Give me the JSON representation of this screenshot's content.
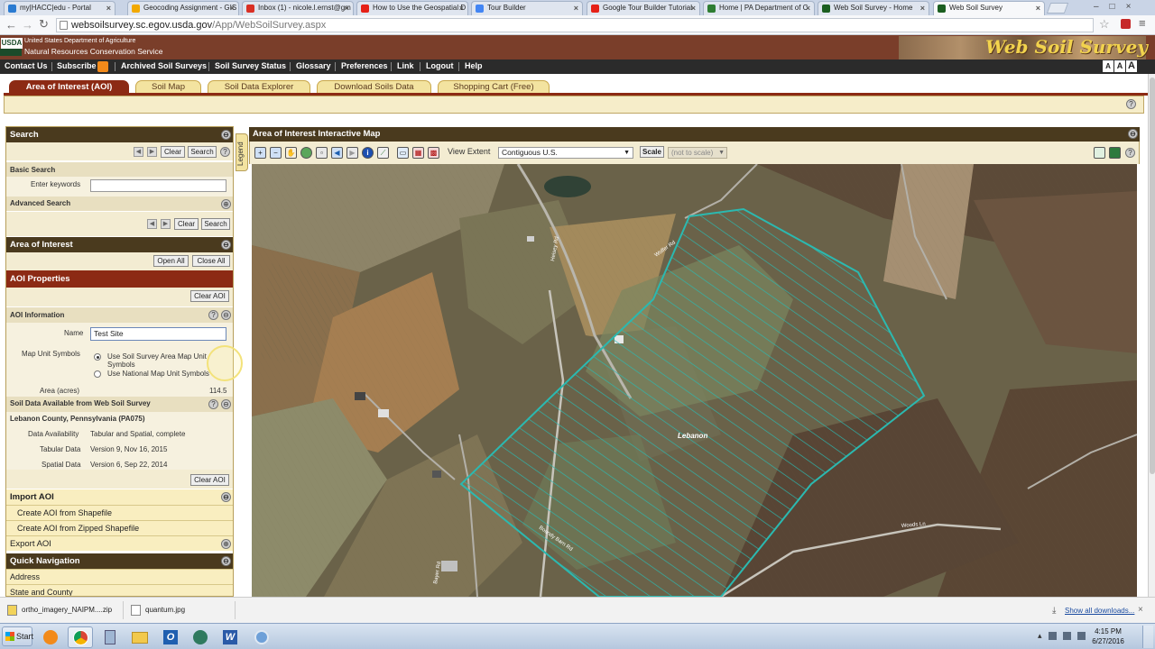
{
  "browser": {
    "tabs": [
      {
        "title": "my|HACC|edu - Portal",
        "color": "#2b7bd1"
      },
      {
        "title": "Geocoding Assignment - GIS",
        "color": "#f2a900"
      },
      {
        "title": "Inbox (1) - nicole.l.ernst@gm",
        "color": "#d93025"
      },
      {
        "title": "How to Use the Geospatial D",
        "color": "#e62117"
      },
      {
        "title": "Tour Builder",
        "color": "#4285f4"
      },
      {
        "title": "Google Tour Builder Tutorial",
        "color": "#e62117"
      },
      {
        "title": "Home | PA Department of C",
        "color": "#2e7d32"
      },
      {
        "title": "Web Soil Survey - Home",
        "color": "#1b5e20"
      },
      {
        "title": "Web Soil Survey",
        "color": "#1b5e20"
      }
    ],
    "url_host": "websoilsurvey.sc.egov.usda.gov",
    "url_path": "/App/WebSoilSurvey.aspx"
  },
  "header": {
    "agency_line1": "United States Department of Agriculture",
    "agency_line2": "Natural Resources Conservation Service",
    "usda": "USDA",
    "logo_title": "Web Soil Survey",
    "font_sizes": [
      "A",
      "A",
      "A"
    ]
  },
  "nav": [
    "Contact Us",
    "Subscribe",
    "Archived Soil Surveys",
    "Soil Survey Status",
    "Glossary",
    "Preferences",
    "Link",
    "Logout",
    "Help"
  ],
  "main_tabs": [
    "Area of Interest (AOI)",
    "Soil Map",
    "Soil Data Explorer",
    "Download Soils Data",
    "Shopping Cart (Free)"
  ],
  "left": {
    "search": {
      "title": "Search",
      "clear": "Clear",
      "search": "Search",
      "basic": "Basic Search",
      "keywords_label": "Enter keywords",
      "keywords_value": "",
      "advanced": "Advanced Search"
    },
    "aoi": {
      "title": "Area of Interest",
      "open_all": "Open All",
      "close_all": "Close All",
      "props_title": "AOI Properties",
      "clear_aoi": "Clear AOI",
      "info_title": "AOI Information",
      "name_label": "Name",
      "name_value": "Test Site",
      "mus_label": "Map Unit Symbols",
      "radio1": "Use Soil Survey Area Map Unit Symbols",
      "radio2": "Use National Map Unit Symbols",
      "area_label": "Area (acres)",
      "area_value": "114.5",
      "soil_data_title": "Soil Data Available from Web Soil Survey",
      "county": "Lebanon County, Pennsylvania (PA075)",
      "rows": [
        {
          "label": "Data Availability",
          "value": "Tabular and Spatial, complete"
        },
        {
          "label": "Tabular Data",
          "value": "Version 9, Nov 16, 2015"
        },
        {
          "label": "Spatial Data",
          "value": "Version 6, Sep 22, 2014"
        }
      ]
    },
    "import": {
      "title": "Import AOI",
      "items": [
        "Create AOI from Shapefile",
        "Create AOI from Zipped Shapefile"
      ]
    },
    "export": "Export AOI",
    "quicknav": {
      "title": "Quick Navigation",
      "items": [
        "Address",
        "State and County"
      ]
    }
  },
  "legend_tab": "Legend",
  "map": {
    "title": "Area of Interest Interactive Map",
    "view_extent_label": "View Extent",
    "view_extent_value": "Contiguous U.S.",
    "scale_button": "Scale",
    "scale_value": "(not to scale)",
    "label_lebanon": "Lebanon",
    "road_labels": [
      "Wolfer Rd",
      "Heisey Rd",
      "Boundy Barn Rd",
      "Woods Ln",
      "Bayer Rd"
    ]
  },
  "downloads": {
    "items": [
      "ortho_imagery_NAIPM....zip",
      "quantum.jpg"
    ],
    "show_all": "Show all downloads..."
  },
  "taskbar": {
    "start": "Start",
    "time": "4:15 PM",
    "date": "6/27/2016"
  },
  "colors": {
    "brand_brown": "#7a3e2a",
    "tab_selected": "#8c2a14",
    "aoi_outline": "#2bb9b0"
  }
}
